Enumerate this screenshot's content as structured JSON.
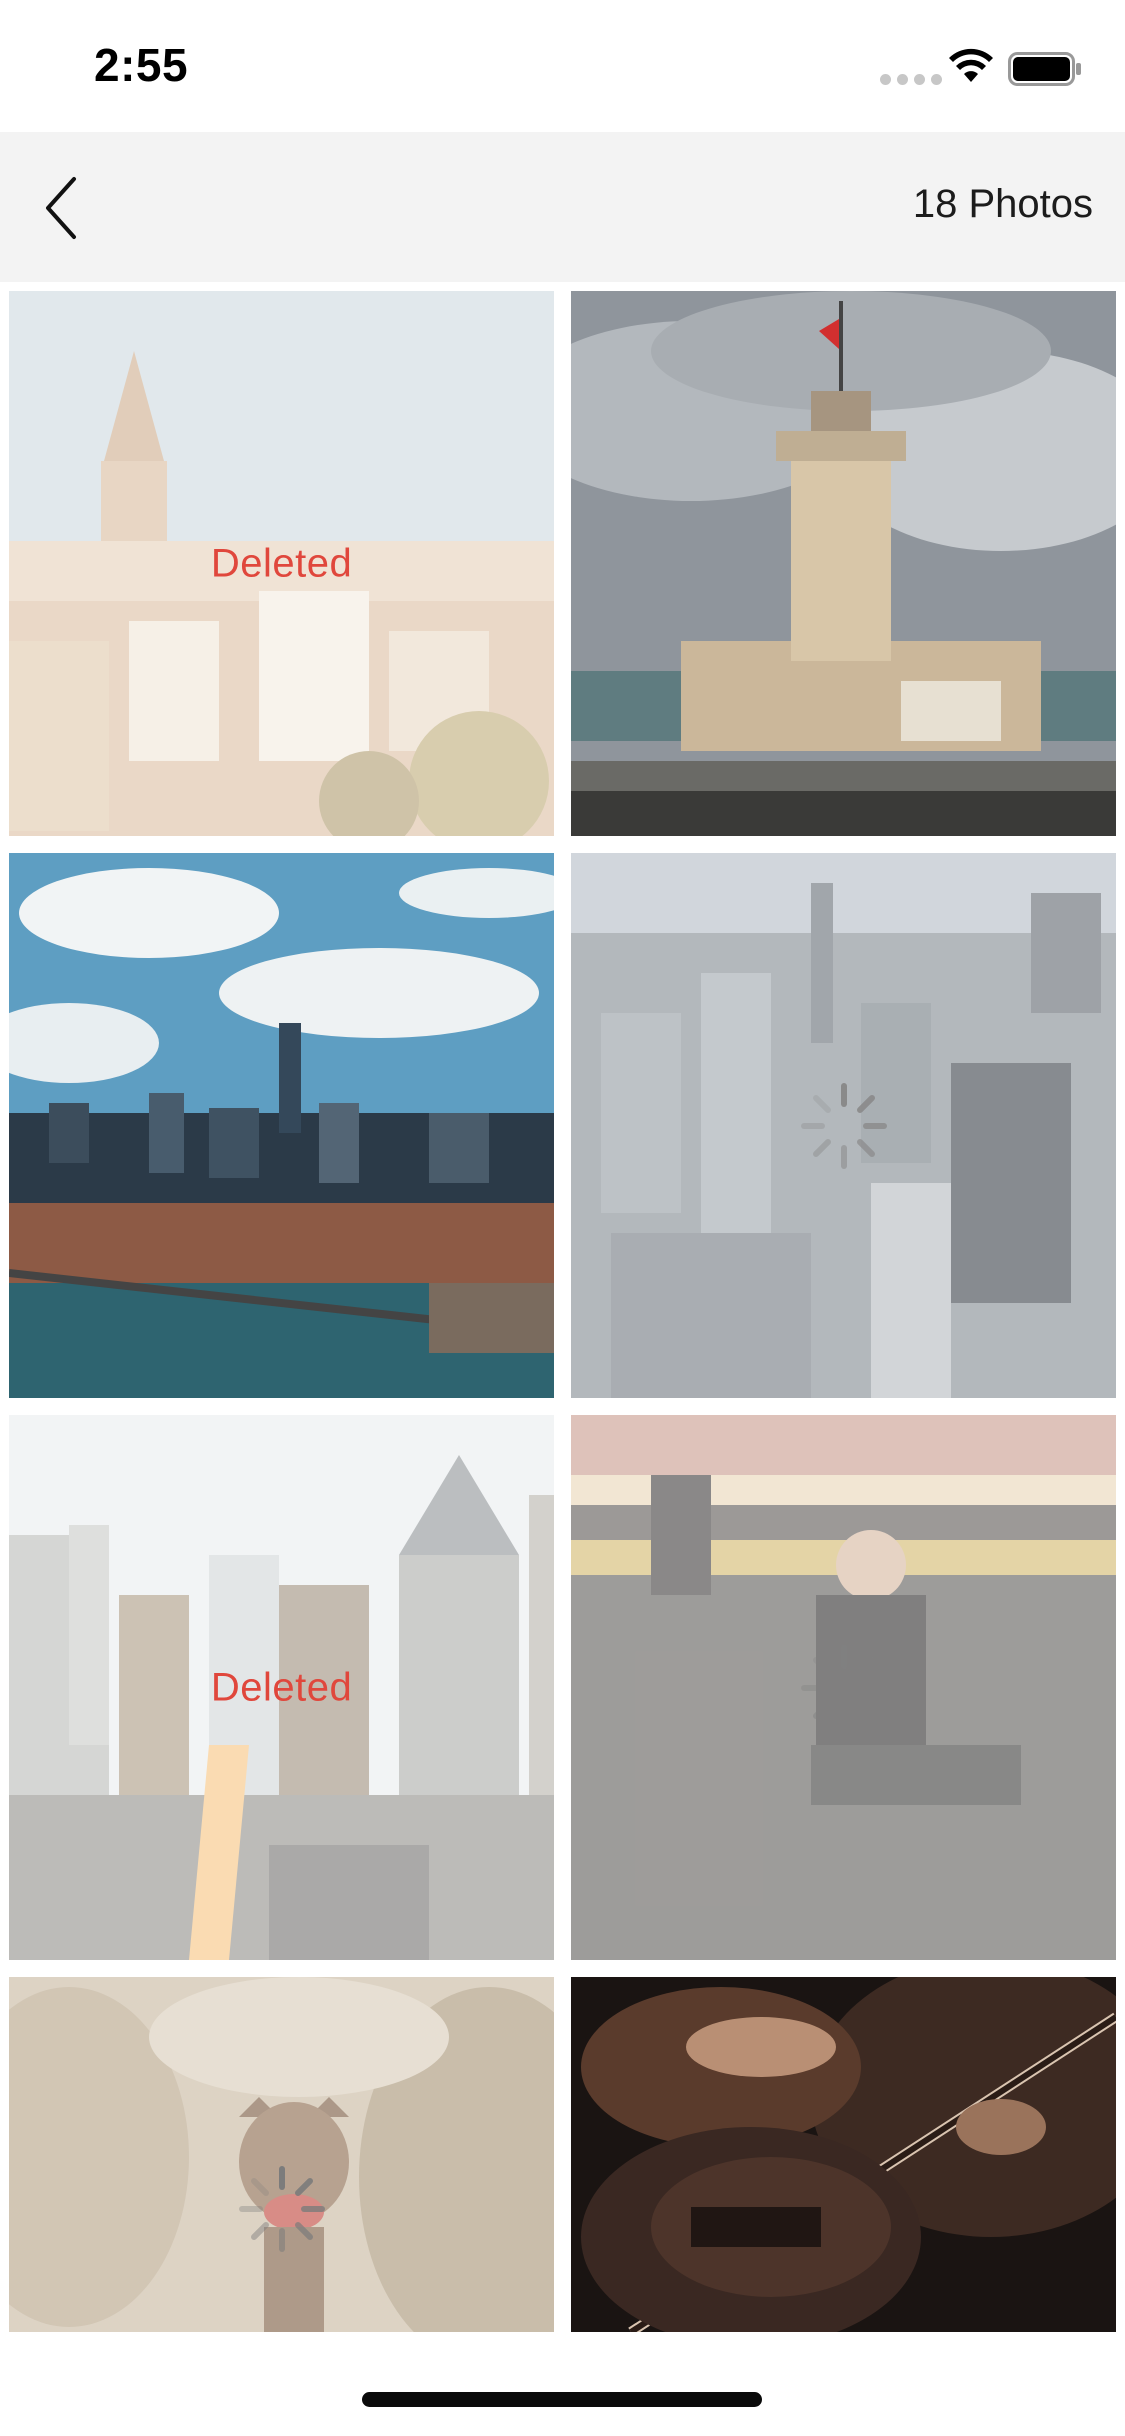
{
  "status_bar": {
    "time": "2:55"
  },
  "nav": {
    "back_icon": "chevron-left-icon",
    "count_label": "18 Photos"
  },
  "photos": [
    {
      "subject": "galata-tower-city",
      "state": "deleted",
      "label": "Deleted"
    },
    {
      "subject": "maidens-tower",
      "state": "normal",
      "label": ""
    },
    {
      "subject": "manhattan-bridge-skyline",
      "state": "normal",
      "label": ""
    },
    {
      "subject": "empire-state-aerial",
      "state": "loading",
      "label": ""
    },
    {
      "subject": "midtown-sunset-street",
      "state": "deleted",
      "label": "Deleted"
    },
    {
      "subject": "person-sitting-graffiti",
      "state": "loading",
      "label": ""
    },
    {
      "subject": "dog-in-field",
      "state": "loading",
      "label": ""
    },
    {
      "subject": "bass-guitar-player",
      "state": "normal",
      "label": ""
    }
  ],
  "colors": {
    "deleted_text": "#e0473c",
    "nav_background": "#f3f3f3"
  }
}
